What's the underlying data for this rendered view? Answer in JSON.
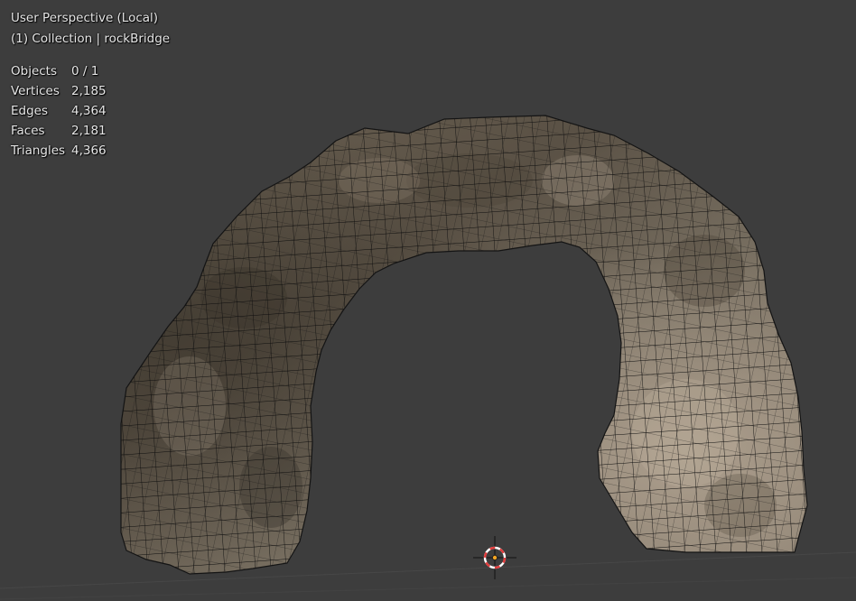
{
  "viewport": {
    "view_name": "User Perspective (Local)",
    "collection_line": "(1) Collection | rockBridge"
  },
  "stats": [
    {
      "label": "Objects",
      "value": "0 / 1"
    },
    {
      "label": "Vertices",
      "value": "2,185"
    },
    {
      "label": "Edges",
      "value": "4,364"
    },
    {
      "label": "Faces",
      "value": "2,181"
    },
    {
      "label": "Triangles",
      "value": "4,366"
    }
  ],
  "colors": {
    "background": "#3d3d3d",
    "grid_line": "#4a4a4a",
    "wire": "#000000",
    "cursor_red": "#e23b3b",
    "cursor_white": "#ffffff",
    "origin_dot": "#f5a623"
  },
  "icons": {
    "cursor": "3d-cursor-icon",
    "origin": "object-origin-icon"
  }
}
